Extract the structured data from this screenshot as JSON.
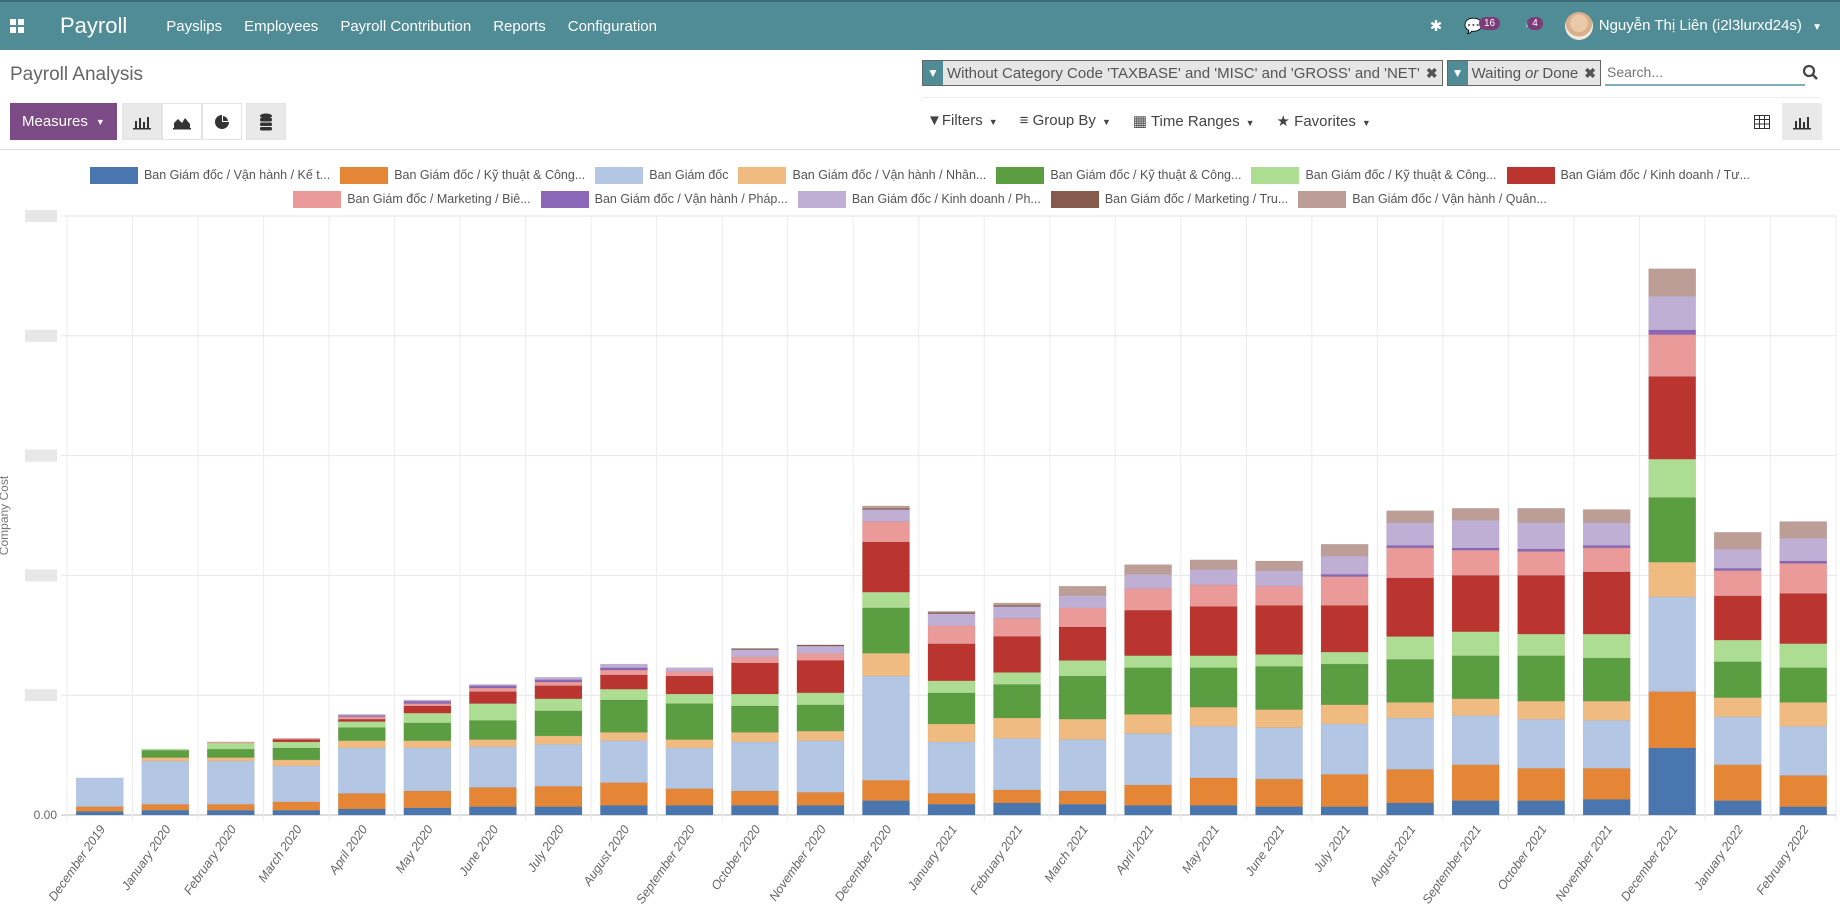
{
  "navbar": {
    "app_name": "Payroll",
    "menu": [
      "Payslips",
      "Employees",
      "Payroll Contribution",
      "Reports",
      "Configuration"
    ],
    "messages_count": "16",
    "activities_count": "4",
    "user_name": "Nguyễn Thị Liên (i2l3lurxd24s)"
  },
  "control_panel": {
    "title": "Payroll Analysis",
    "measures_label": "Measures",
    "facets": [
      {
        "label": "Without Category Code 'TAXBASE' and 'MISC' and 'GROSS' and 'NET'"
      },
      {
        "label_a": "Waiting ",
        "label_or": "or",
        "label_b": " Done"
      }
    ],
    "search_placeholder": "Search...",
    "filters_label": "Filters",
    "groupby_label": "Group By",
    "timeranges_label": "Time Ranges",
    "favorites_label": "Favorites"
  },
  "chart_data": {
    "type": "bar",
    "stacked": true,
    "title": "",
    "xlabel": "",
    "ylabel": "Company Cost",
    "y_tick_labels_visible": [
      "0.00"
    ],
    "y_tick_labels_note": "other y tick labels are blurred/unreadable; values below are in gridline units (1 unit = one gridline interval)",
    "ylim": [
      0,
      5
    ],
    "grid": true,
    "legend_position": "top",
    "categories": [
      "December 2019",
      "January 2020",
      "February 2020",
      "March 2020",
      "April 2020",
      "May 2020",
      "June 2020",
      "July 2020",
      "August 2020",
      "September 2020",
      "October 2020",
      "November 2020",
      "December 2020",
      "January 2021",
      "February 2021",
      "March 2021",
      "April 2021",
      "May 2021",
      "June 2021",
      "July 2021",
      "August 2021",
      "September 2021",
      "October 2021",
      "November 2021",
      "December 2021",
      "January 2022",
      "February 2022"
    ],
    "series": [
      {
        "name": "Ban Giám đốc / Vận hành / Kế t...",
        "color": "#4a76b0",
        "values": [
          0.03,
          0.04,
          0.04,
          0.04,
          0.05,
          0.06,
          0.07,
          0.07,
          0.08,
          0.08,
          0.08,
          0.08,
          0.12,
          0.09,
          0.1,
          0.09,
          0.08,
          0.08,
          0.07,
          0.07,
          0.1,
          0.12,
          0.12,
          0.13,
          0.56,
          0.12,
          0.07
        ]
      },
      {
        "name": "Ban Giám đốc / Kỹ thuật & Công...",
        "color": "#e58636",
        "values": [
          0.04,
          0.05,
          0.05,
          0.07,
          0.13,
          0.14,
          0.16,
          0.17,
          0.19,
          0.14,
          0.12,
          0.11,
          0.17,
          0.09,
          0.11,
          0.11,
          0.17,
          0.23,
          0.23,
          0.27,
          0.28,
          0.3,
          0.27,
          0.26,
          0.47,
          0.3,
          0.26
        ]
      },
      {
        "name": "Ban Giám đốc",
        "color": "#b3c6e4",
        "values": [
          0.24,
          0.36,
          0.36,
          0.3,
          0.38,
          0.36,
          0.34,
          0.35,
          0.35,
          0.34,
          0.41,
          0.43,
          0.87,
          0.43,
          0.43,
          0.43,
          0.43,
          0.43,
          0.43,
          0.42,
          0.43,
          0.41,
          0.41,
          0.4,
          0.79,
          0.4,
          0.41
        ]
      },
      {
        "name": "Ban Giám đốc / Vận hành / Nhân...",
        "color": "#f0bb80",
        "values": [
          0,
          0.03,
          0.03,
          0.05,
          0.06,
          0.06,
          0.06,
          0.07,
          0.07,
          0.07,
          0.08,
          0.08,
          0.19,
          0.15,
          0.17,
          0.17,
          0.16,
          0.16,
          0.15,
          0.16,
          0.13,
          0.14,
          0.15,
          0.16,
          0.29,
          0.16,
          0.2
        ]
      },
      {
        "name": "Ban Giám đốc / Kỹ thuật & Công...",
        "color": "#5b9e41",
        "values": [
          0,
          0.06,
          0.07,
          0.1,
          0.11,
          0.15,
          0.16,
          0.21,
          0.27,
          0.3,
          0.22,
          0.22,
          0.38,
          0.26,
          0.28,
          0.36,
          0.39,
          0.33,
          0.36,
          0.34,
          0.36,
          0.36,
          0.38,
          0.36,
          0.54,
          0.3,
          0.29
        ]
      },
      {
        "name": "Ban Giám đốc / Kỹ thuật & Công...",
        "color": "#addd92",
        "values": [
          0,
          0.01,
          0.05,
          0.05,
          0.05,
          0.08,
          0.14,
          0.1,
          0.09,
          0.08,
          0.1,
          0.1,
          0.13,
          0.1,
          0.1,
          0.13,
          0.1,
          0.1,
          0.1,
          0.1,
          0.19,
          0.2,
          0.18,
          0.2,
          0.32,
          0.18,
          0.2
        ]
      },
      {
        "name": "Ban Giám đốc / Kinh doanh / Tư...",
        "color": "#bb3530",
        "values": [
          0,
          0,
          0,
          0.02,
          0.02,
          0.06,
          0.1,
          0.11,
          0.12,
          0.15,
          0.26,
          0.27,
          0.42,
          0.31,
          0.3,
          0.28,
          0.38,
          0.41,
          0.41,
          0.39,
          0.49,
          0.47,
          0.49,
          0.52,
          0.69,
          0.37,
          0.42
        ]
      },
      {
        "name": "Ban Giám đốc / Marketing / Biê...",
        "color": "#ea9a98",
        "values": [
          0,
          0,
          0.01,
          0.01,
          0.02,
          0.02,
          0.03,
          0.03,
          0.04,
          0.04,
          0.05,
          0.06,
          0.17,
          0.15,
          0.15,
          0.16,
          0.18,
          0.18,
          0.16,
          0.24,
          0.25,
          0.21,
          0.2,
          0.2,
          0.35,
          0.21,
          0.25
        ]
      },
      {
        "name": "Ban Giám đốc / Vận hành / Pháp...",
        "color": "#8c67b8",
        "values": [
          0,
          0,
          0,
          0,
          0.01,
          0.02,
          0.02,
          0.02,
          0.02,
          0,
          0,
          0,
          0,
          0,
          0,
          0,
          0,
          0,
          0,
          0.02,
          0.02,
          0.02,
          0.02,
          0.02,
          0.04,
          0.02,
          0.02
        ]
      },
      {
        "name": "Ban Giám đốc / Kinh doanh / Ph...",
        "color": "#c0afd4",
        "values": [
          0,
          0,
          0,
          0,
          0.01,
          0.01,
          0.01,
          0.02,
          0.03,
          0.03,
          0.06,
          0.06,
          0.1,
          0.1,
          0.1,
          0.1,
          0.12,
          0.13,
          0.13,
          0.15,
          0.19,
          0.23,
          0.22,
          0.19,
          0.28,
          0.16,
          0.19
        ]
      },
      {
        "name": "Ban Giám đốc / Marketing / Tru...",
        "color": "#875a4e",
        "values": [
          0,
          0,
          0,
          0,
          0,
          0,
          0,
          0,
          0,
          0,
          0.01,
          0.01,
          0.01,
          0.01,
          0.01,
          0,
          0,
          0,
          0,
          0,
          0,
          0,
          0,
          0,
          0,
          0,
          0
        ]
      },
      {
        "name": "Ban Giám đốc / Vận hành / Quân...",
        "color": "#bd9e97",
        "values": [
          0,
          0,
          0,
          0,
          0,
          0,
          0,
          0,
          0,
          0,
          0,
          0,
          0.02,
          0.01,
          0.02,
          0.08,
          0.08,
          0.08,
          0.08,
          0.1,
          0.1,
          0.1,
          0.12,
          0.11,
          0.23,
          0.14,
          0.14
        ]
      }
    ]
  }
}
